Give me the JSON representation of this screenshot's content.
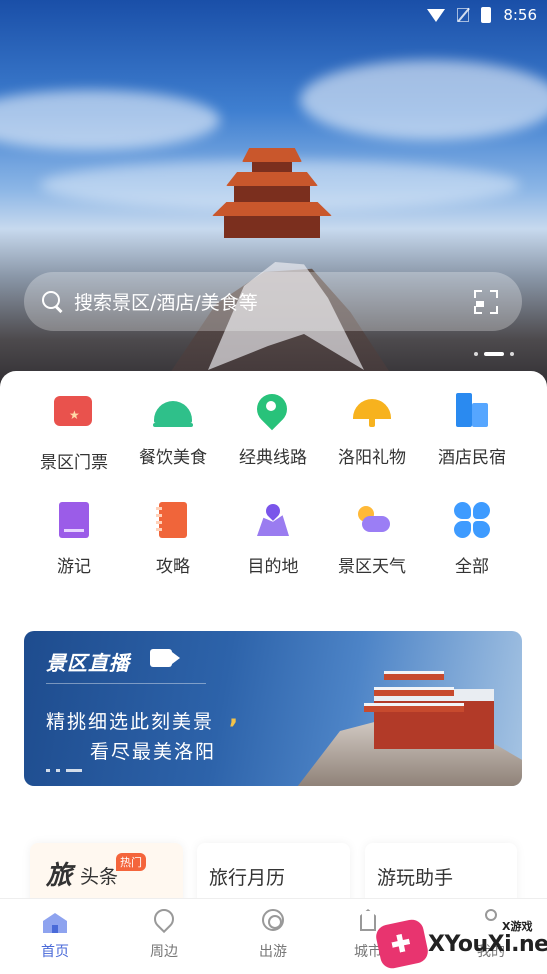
{
  "status_bar": {
    "time": "8:56"
  },
  "search": {
    "placeholder": "搜索景区/酒店/美食等"
  },
  "categories": [
    {
      "label": "景区门票",
      "icon": "ticket-icon"
    },
    {
      "label": "餐饮美食",
      "icon": "cloche-icon"
    },
    {
      "label": "经典线路",
      "icon": "route-pin-icon"
    },
    {
      "label": "洛阳礼物",
      "icon": "fan-icon"
    },
    {
      "label": "酒店民宿",
      "icon": "hotel-icon"
    },
    {
      "label": "游记",
      "icon": "book-icon"
    },
    {
      "label": "攻略",
      "icon": "notebook-icon"
    },
    {
      "label": "目的地",
      "icon": "destination-icon"
    },
    {
      "label": "景区天气",
      "icon": "weather-icon"
    },
    {
      "label": "全部",
      "icon": "grid-all-icon"
    }
  ],
  "banner": {
    "title": "景区直播",
    "line1": "精挑细选此刻美景",
    "line2": "看尽最美洛阳",
    "comma": ","
  },
  "mini_cards": {
    "headline_big": "旅",
    "headline_small": "头条",
    "hot_badge": "热门",
    "calendar": "旅行月历",
    "helper": "游玩助手"
  },
  "tabs": [
    {
      "label": "首页",
      "active": true
    },
    {
      "label": "周边",
      "active": false
    },
    {
      "label": "出游",
      "active": false
    },
    {
      "label": "城市",
      "active": false
    },
    {
      "label": "我的",
      "active": false
    }
  ],
  "watermark": {
    "text": "XYouXi.net",
    "small": "X游戏"
  },
  "colors": {
    "accent": "#4a6ad8",
    "ticket": "#e9524d",
    "food": "#2fc08a",
    "gift": "#f7b21e",
    "hotel": "#2a8af0",
    "purple": "#9b5ce8"
  }
}
